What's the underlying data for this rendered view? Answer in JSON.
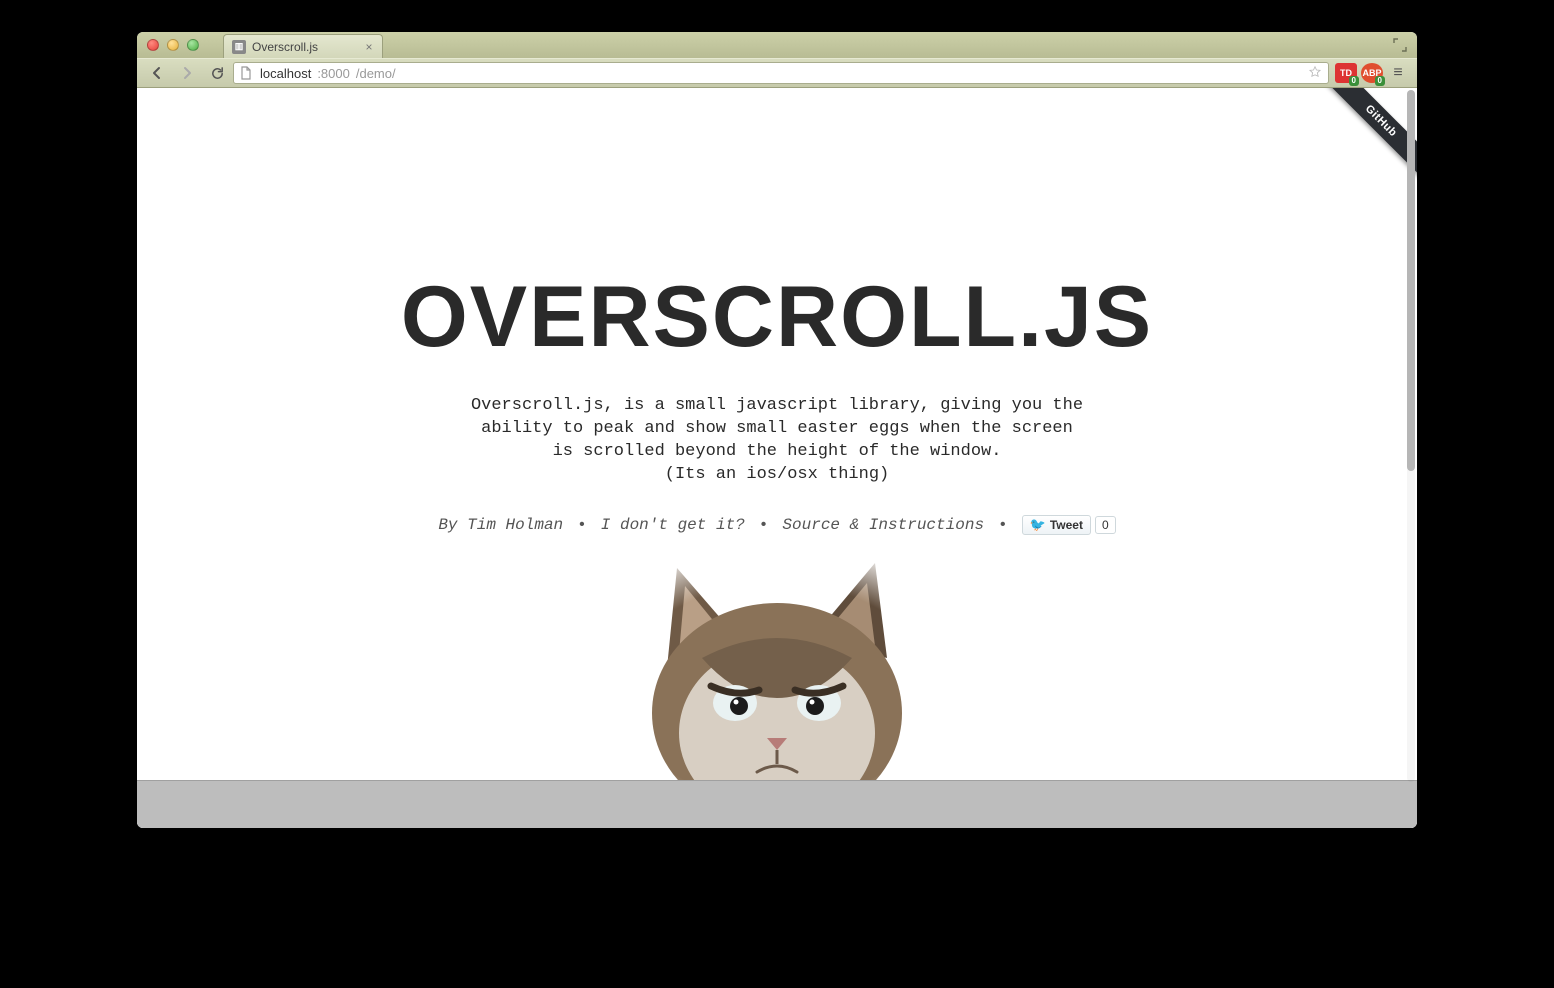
{
  "window": {
    "tab_title": "Overscroll.js",
    "url_host": "localhost",
    "url_port": ":8000",
    "url_path": "/demo/"
  },
  "ribbon": {
    "label": "GitHub"
  },
  "extensions": {
    "td_label": "TD",
    "td_badge": "0",
    "abp_label": "ABP",
    "abp_badge": "0"
  },
  "page": {
    "title": "OVERSCROLL.JS",
    "blurb": "Overscroll.js, is a small javascript library, giving you the\nability to peak and show small easter eggs when the screen\nis scrolled beyond the height of the window.\n(Its an ios/osx thing)",
    "links": {
      "author": "By Tim Holman",
      "confused": "I don't get it?",
      "source": "Source & Instructions",
      "sep": "•"
    },
    "tweet": {
      "label": "Tweet",
      "count": "0"
    }
  }
}
